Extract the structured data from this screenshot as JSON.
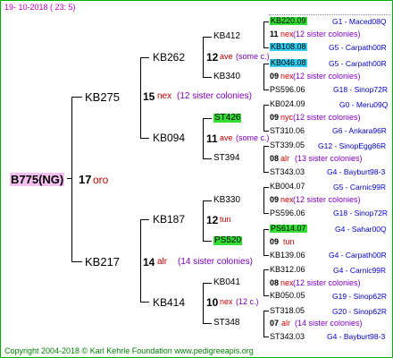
{
  "date": "19- 10-2018 ( 23: 5)",
  "footer": "Copyright 2004-2018 © Karl Kehrle Foundation   www.pedigreeapis.org",
  "root": {
    "name": "B775(NG)",
    "num": "17",
    "tag": "oro"
  },
  "gen1": [
    {
      "name": "KB275",
      "num": "15",
      "tag": "nex",
      "sis": "(12 sister colonies)"
    },
    {
      "name": "KB217",
      "num": "14",
      "tag": "alr",
      "sis": "(14 sister colonies)"
    }
  ],
  "gen2": [
    {
      "name": "KB262",
      "num": "12",
      "tag": "ave",
      "sis": "(some c.)"
    },
    {
      "name": "KB094",
      "num": "11",
      "tag": "ave",
      "sis": "(some c.)"
    },
    {
      "name": "KB187",
      "num": "12",
      "tag": "tun",
      "sis": ""
    },
    {
      "name": "KB414",
      "num": "10",
      "tag": "nex",
      "sis": "(12 c.)"
    }
  ],
  "gen3": [
    {
      "name": "KB412"
    },
    {
      "name": "KB340"
    },
    {
      "name": "ST426"
    },
    {
      "name": "ST394"
    },
    {
      "name": "KB330"
    },
    {
      "name": "PS520"
    },
    {
      "name": "KB041"
    },
    {
      "name": "ST348"
    }
  ],
  "gen4": [
    {
      "name": "KB220.09",
      "info": "G1 - Maced08Q"
    },
    {
      "num": "11",
      "tag": "nex",
      "sis": "(12 sister colonies)"
    },
    {
      "name": "KB108.08",
      "info": "G5 - Carpath00R"
    },
    {
      "name": "KB046.08",
      "info": "G5 - Carpath00R"
    },
    {
      "num": "09",
      "tag": "nex",
      "sis": "(12 sister colonies)"
    },
    {
      "name": "PS596.06",
      "info": "G18 - Sinop72R"
    },
    {
      "name": "KB024.09",
      "info": "G0 - Meru09Q"
    },
    {
      "num": "09",
      "tag": "nyc",
      "sis": "(12 sister colonies)"
    },
    {
      "name": "ST310.06",
      "info": "G6 - Ankara96R"
    },
    {
      "name": "ST339.05",
      "info": "G12 - SinopEgg86R"
    },
    {
      "num": "08",
      "tag": "alr",
      "sis": "(13 sister colonies)"
    },
    {
      "name": "ST343.03",
      "info": "G4 - Bayburt98-3"
    },
    {
      "name": "KB004.07",
      "info": "G5 - Carnic99R"
    },
    {
      "num": "09",
      "tag": "nex",
      "sis": "(12 sister colonies)"
    },
    {
      "name": "PS596.06",
      "info": "G18 - Sinop72R"
    },
    {
      "name": "PS614.07",
      "info": "G4 - Sahar00Q"
    },
    {
      "num": "09",
      "tag": "tun",
      "sis": ""
    },
    {
      "name": "KB139.06",
      "info": "G4 - Carpath00R"
    },
    {
      "name": "KB312.06",
      "info": "G4 - Carnic99R"
    },
    {
      "num": "08",
      "tag": "nex",
      "sis": "(12 sister colonies)"
    },
    {
      "name": "KB050.05",
      "info": "G19 - Sinop62R"
    },
    {
      "name": "ST318.05",
      "info": "G20 - Sinop62R"
    },
    {
      "num": "07",
      "tag": "alr",
      "sis": "(14 sister colonies)"
    },
    {
      "name": "ST343.03",
      "info": "G4 - Bayburt98-3"
    }
  ]
}
